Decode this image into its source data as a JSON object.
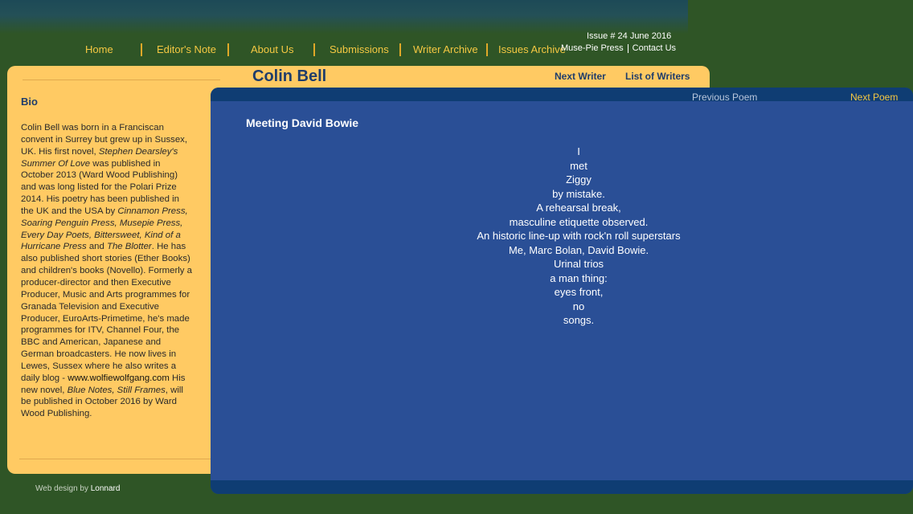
{
  "nav": {
    "items": [
      "Home",
      "Editor's Note",
      "About Us",
      "Submissions",
      "Writer Archive",
      "Issues Archive"
    ]
  },
  "issue": {
    "label": "Issue # 24 June 2016"
  },
  "publisher": {
    "name": "Muse-Pie Press",
    "contact": "Contact Us"
  },
  "writer": {
    "name": "Colin Bell",
    "next_writer": "Next Writer",
    "list_of_writers": "List of Writers"
  },
  "bio": {
    "heading": "Bio",
    "t1": "Colin Bell was born in a Franciscan convent in Surrey but grew up in Sussex, UK. His first novel, ",
    "i1": "Stephen Dearsley's Summer Of Love",
    "t2": " was published in October 2013 (Ward Wood Publishing) and was long listed for the Polari Prize 2014. His poetry has been published in the UK and the USA by ",
    "i2": "Cinnamon Press, Soaring Penguin Press, Musepie Press, Every Day Poets, Bittersweet, Kind of a Hurricane Press",
    "t3": " and ",
    "i3": "The Blotter",
    "t4": ". He has also published short stories (Ether Books) and children's books (Novello). Formerly a producer-director and then Executive Producer, Music and Arts programmes for Granada Television and Executive Producer, EuroArts-Primetime, he's made programmes for ITV, Channel Four, the BBC and American, Japanese and German broadcasters. He now lives in Lewes, Sussex where he also writes a daily blog - ",
    "link": "www.wolfiewolfgang.com",
    "t5": " His new novel, ",
    "i4": "Blue Notes, Still Frames",
    "t6": ", will be published in October 2016 by Ward Wood Publishing."
  },
  "poem": {
    "previous": "Previous Poem",
    "next": "Next Poem",
    "title": "Meeting David Bowie",
    "lines": [
      "I",
      "met",
      "Ziggy",
      "by mistake.",
      "A rehearsal break,",
      "masculine etiquette observed.",
      "An historic line-up with rock'n roll superstars",
      "Me, Marc Bolan, David Bowie.",
      "Urinal trios",
      "a man thing:",
      "eyes front,",
      "no",
      "songs."
    ]
  },
  "footer": {
    "prefix": "Web design by",
    "designer": "Lonnard"
  },
  "colors": {
    "background": "#2f5526",
    "panel_yellow": "#ffca63",
    "panel_blue": "#2a4f96",
    "nav_text": "#f5c842",
    "title_text": "#1f3d6b"
  }
}
